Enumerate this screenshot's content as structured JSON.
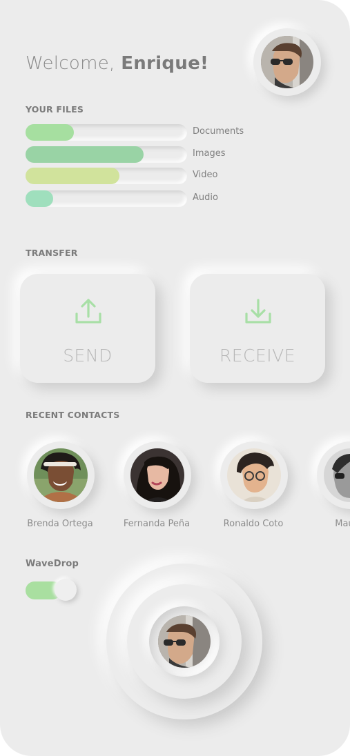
{
  "header": {
    "greeting": "Welcome,",
    "user_name": "Enrique!"
  },
  "files": {
    "title": "YOUR FILES",
    "items": [
      {
        "label": "Documents",
        "fill_fraction": 0.3,
        "color": "#a6dfa0"
      },
      {
        "label": "Images",
        "fill_fraction": 0.73,
        "color": "#99d3a5"
      },
      {
        "label": "Video",
        "fill_fraction": 0.58,
        "color": "#d1e39c"
      },
      {
        "label": "Audio",
        "fill_fraction": 0.17,
        "color": "#9fdfbd"
      }
    ]
  },
  "transfer": {
    "title": "TRANSFER",
    "send_label": "SEND",
    "receive_label": "RECEIVE",
    "icon_color": "#a8dfa6"
  },
  "contacts": {
    "title": "RECENT CONTACTS",
    "items": [
      {
        "name": "Brenda Ortega"
      },
      {
        "name": "Fernanda Peña"
      },
      {
        "name": "Ronaldo Coto"
      },
      {
        "name": "Mauric"
      }
    ]
  },
  "wavedrop": {
    "title": "WaveDrop",
    "enabled": true
  }
}
